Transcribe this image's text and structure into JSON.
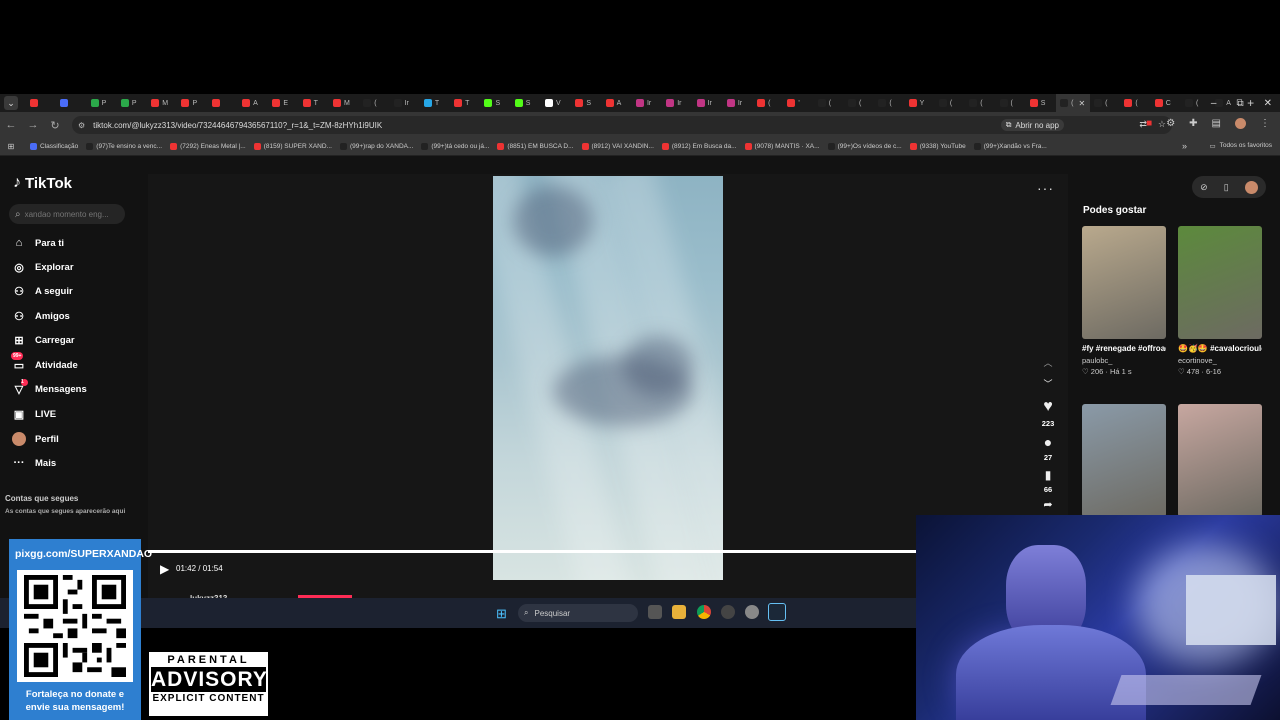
{
  "browser": {
    "tabs": [
      {
        "label": "",
        "color": "#e33"
      },
      {
        "label": "",
        "color": "#4a6cf7"
      },
      {
        "label": "P",
        "color": "#2ba84a"
      },
      {
        "label": "P",
        "color": "#2ba84a"
      },
      {
        "label": "M",
        "color": "#e33"
      },
      {
        "label": "P",
        "color": "#e33"
      },
      {
        "label": "",
        "color": "#e33"
      },
      {
        "label": "A",
        "color": "#e33"
      },
      {
        "label": "E",
        "color": "#e33"
      },
      {
        "label": "T",
        "color": "#e33"
      },
      {
        "label": "M",
        "color": "#e33"
      },
      {
        "label": "(",
        "color": "#222"
      },
      {
        "label": "Ir",
        "color": "#222"
      },
      {
        "label": "T",
        "color": "#27a7e7"
      },
      {
        "label": "T",
        "color": "#e33"
      },
      {
        "label": "S",
        "color": "#53fc18"
      },
      {
        "label": "S",
        "color": "#53fc18"
      },
      {
        "label": "V",
        "color": "#fff"
      },
      {
        "label": "S",
        "color": "#e33"
      },
      {
        "label": "A",
        "color": "#e33"
      },
      {
        "label": "Ir",
        "color": "#c13584"
      },
      {
        "label": "Ir",
        "color": "#c13584"
      },
      {
        "label": "Ir",
        "color": "#c13584"
      },
      {
        "label": "Ir",
        "color": "#c13584"
      },
      {
        "label": "(",
        "color": "#e33"
      },
      {
        "label": "'",
        "color": "#e33"
      },
      {
        "label": "(",
        "color": "#222"
      },
      {
        "label": "(",
        "color": "#222"
      },
      {
        "label": "(",
        "color": "#222"
      },
      {
        "label": "Y",
        "color": "#e33"
      },
      {
        "label": "(",
        "color": "#222"
      },
      {
        "label": "(",
        "color": "#222"
      },
      {
        "label": "(",
        "color": "#222"
      },
      {
        "label": "S",
        "color": "#e33"
      }
    ],
    "active_tab": {
      "label": "(",
      "close": "✕"
    },
    "tabs_after": [
      {
        "label": "(",
        "color": "#222"
      },
      {
        "label": "(",
        "color": "#e33"
      },
      {
        "label": "C",
        "color": "#e33"
      },
      {
        "label": "(",
        "color": "#222"
      },
      {
        "label": "A",
        "color": "#222"
      }
    ],
    "new_tab": "+",
    "window_controls": {
      "minimize": "–",
      "maximize": "⧉",
      "close": "✕"
    },
    "url": "tiktok.com/@lukyzz313/video/7324464679436567110?_r=1&_t=ZM-8zHYh1i9UIK",
    "open_app": "Abrir no app",
    "bookmarks": [
      {
        "label": "Classificação",
        "color": "#4a6cf7"
      },
      {
        "label": "(97)Te ensino a venc...",
        "color": "#222"
      },
      {
        "label": "(7292) Eneas Metal |...",
        "color": "#e33"
      },
      {
        "label": "(8159) SUPER XAND...",
        "color": "#e33"
      },
      {
        "label": "(99+)rap do XANDÃ...",
        "color": "#222"
      },
      {
        "label": "(99+)tá cedo ou já...",
        "color": "#222"
      },
      {
        "label": "(8851) EM BUSCA D...",
        "color": "#e33"
      },
      {
        "label": "(8912) VAI XANDIN...",
        "color": "#e33"
      },
      {
        "label": "(8912) Em Busca da...",
        "color": "#e33"
      },
      {
        "label": "(9078) MANTIS · XA...",
        "color": "#e33"
      },
      {
        "label": "(99+)Os vídeos de c...",
        "color": "#222"
      },
      {
        "label": "(9338) YouTube",
        "color": "#e33"
      },
      {
        "label": "(99+)Xandão vs Fra...",
        "color": "#222"
      }
    ],
    "all_bookmarks": "Todos os favoritos"
  },
  "tiktok": {
    "logo": "TikTok",
    "search_placeholder": "xandao momento eng...",
    "nav": [
      {
        "label": "Para ti",
        "icon": "home-icon",
        "glyph": "⌂"
      },
      {
        "label": "Explorar",
        "icon": "compass-icon",
        "glyph": "◎"
      },
      {
        "label": "A seguir",
        "icon": "following-icon",
        "glyph": "⚇"
      },
      {
        "label": "Amigos",
        "icon": "friends-icon",
        "glyph": "⚇"
      },
      {
        "label": "Carregar",
        "icon": "upload-icon",
        "glyph": "⊞"
      },
      {
        "label": "Atividade",
        "icon": "activity-icon",
        "glyph": "▭",
        "badge": "99+"
      },
      {
        "label": "Mensagens",
        "icon": "messages-icon",
        "glyph": "▽",
        "badge": "1"
      },
      {
        "label": "LIVE",
        "icon": "live-icon",
        "glyph": "▣"
      },
      {
        "label": "Perfil",
        "icon": "avatar",
        "glyph": "●"
      },
      {
        "label": "Mais",
        "icon": "more-icon",
        "glyph": "···"
      }
    ],
    "following_title": "Contas que segues",
    "following_sub": "As contas que segues aparecerão aqui",
    "player": {
      "more": "···",
      "time": "01:42 / 01:54",
      "progress": 0.93,
      "author": "lukyzz313"
    },
    "actions": {
      "up": "︿",
      "down": "﹀",
      "likes": "223",
      "comments": "27",
      "saves": "66"
    },
    "suggested_title": "Podes gostar",
    "suggested": [
      {
        "caption": "#fy #renegade #offroad #mulhere...",
        "author": "paulobc_",
        "stats": "♡ 206 · Há 1 s",
        "bg": "#b9a98d"
      },
      {
        "caption": "🤩🥳🤩 #cavalocrioulo...",
        "author": "ecortinove_",
        "stats": "♡ 478 · 6-16",
        "bg": "#5c8a3c"
      },
      {
        "caption": "",
        "author": "",
        "stats": "",
        "bg": "#8a9aa8"
      },
      {
        "caption": "",
        "author": "",
        "stats": "",
        "bg": "#c7a7a0"
      }
    ]
  },
  "taskbar": {
    "search": "Pesquisar"
  },
  "overlay": {
    "qr_url": "pixgg.com/SUPERXANDAO",
    "qr_text_1": "Fortaleça no donate e",
    "qr_text_2": "envie sua mensagem!",
    "advisory_top": "PARENTAL",
    "advisory_mid": "ADVISORY",
    "advisory_bot": "EXPLICIT CONTENT"
  }
}
